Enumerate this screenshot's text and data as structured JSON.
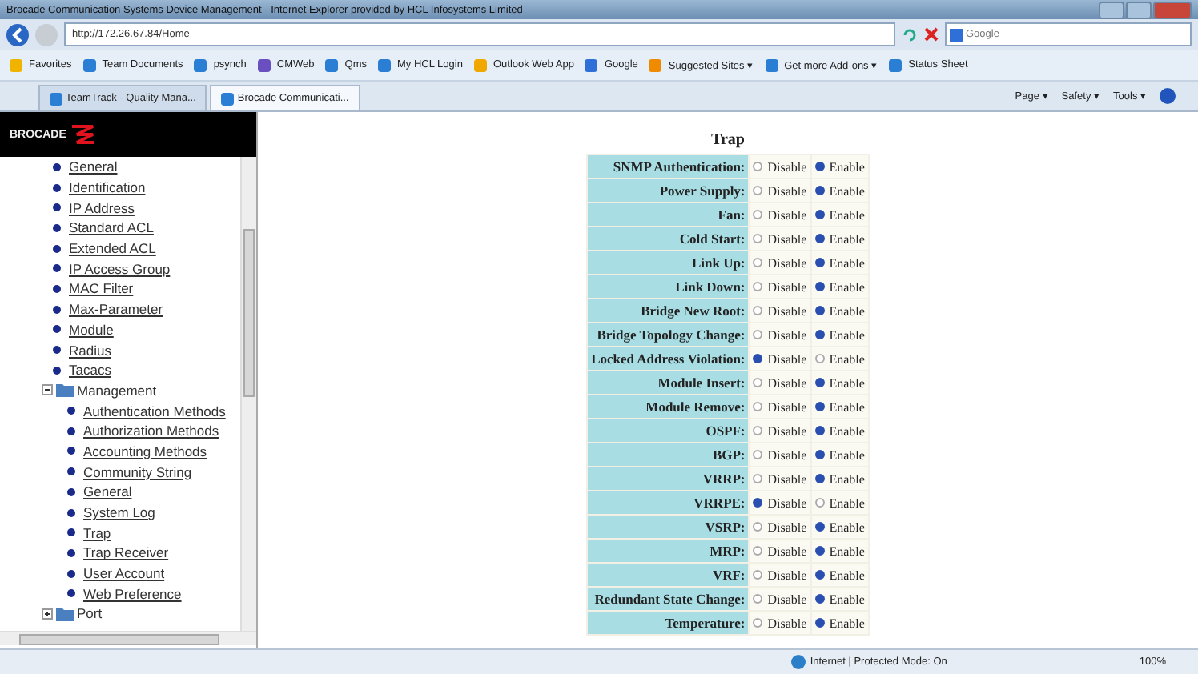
{
  "window": {
    "title": "Brocade Communication Systems Device Management - Internet Explorer provided by HCL Infosystems Limited"
  },
  "address": {
    "value": "http://172.26.67.84/Home"
  },
  "search": {
    "placeholder": "Google"
  },
  "favorites": [
    {
      "label": "Favorites",
      "kind": "star"
    },
    {
      "label": "Team Documents",
      "kind": "page"
    },
    {
      "label": "psynch",
      "kind": "page"
    },
    {
      "label": "CMWeb",
      "kind": "gear"
    },
    {
      "label": "Qms",
      "kind": "page"
    },
    {
      "label": "My HCL Login",
      "kind": "page"
    },
    {
      "label": "Outlook Web App",
      "kind": "mail"
    },
    {
      "label": "Google",
      "kind": "google"
    },
    {
      "label": "Suggested Sites ▾",
      "kind": "feed"
    },
    {
      "label": "Get more Add-ons ▾",
      "kind": "page"
    },
    {
      "label": "Status Sheet",
      "kind": "page"
    }
  ],
  "tabs": [
    {
      "label": "TeamTrack - Quality Mana...",
      "selected": false
    },
    {
      "label": "Brocade Communicati...",
      "selected": true
    }
  ],
  "commands": [
    "Page ▾",
    "Safety ▾",
    "Tools ▾"
  ],
  "sidebar": {
    "logo": "BROCADE",
    "items": [
      {
        "label": "General"
      },
      {
        "label": "Identification"
      },
      {
        "label": "IP Address"
      },
      {
        "label": "Standard ACL"
      },
      {
        "label": "Extended ACL"
      },
      {
        "label": "IP Access Group"
      },
      {
        "label": "MAC Filter"
      },
      {
        "label": "Max-Parameter"
      },
      {
        "label": "Module"
      },
      {
        "label": "Radius"
      },
      {
        "label": "Tacacs"
      },
      {
        "label": "Management",
        "expanded": true,
        "children": [
          {
            "label": "Authentication Methods"
          },
          {
            "label": "Authorization Methods"
          },
          {
            "label": "Accounting Methods"
          },
          {
            "label": "Community String"
          },
          {
            "label": "General"
          },
          {
            "label": "System Log"
          },
          {
            "label": "Trap"
          },
          {
            "label": "Trap Receiver"
          },
          {
            "label": "User Account"
          },
          {
            "label": "Web Preference"
          }
        ]
      },
      {
        "label": "Port",
        "expanded": false
      }
    ]
  },
  "trap": {
    "title": "Trap",
    "rows": [
      {
        "label": "SNMP Authentication:",
        "options": [
          {
            "label": "Disable",
            "selected": false
          },
          {
            "label": "Enable",
            "selected": true
          }
        ]
      },
      {
        "label": "Power Supply:",
        "options": [
          {
            "label": "Disable",
            "selected": false
          },
          {
            "label": "Enable",
            "selected": true
          }
        ]
      },
      {
        "label": "Fan:",
        "options": [
          {
            "label": "Disable",
            "selected": false
          },
          {
            "label": "Enable",
            "selected": true
          }
        ]
      },
      {
        "label": "Cold Start:",
        "options": [
          {
            "label": "Disable",
            "selected": false
          },
          {
            "label": "Enable",
            "selected": true
          }
        ]
      },
      {
        "label": "Link Up:",
        "options": [
          {
            "label": "Disable",
            "selected": false
          },
          {
            "label": "Enable",
            "selected": true
          }
        ]
      },
      {
        "label": "Link Down:",
        "options": [
          {
            "label": "Disable",
            "selected": false
          },
          {
            "label": "Enable",
            "selected": true
          }
        ]
      },
      {
        "label": "Bridge New Root:",
        "options": [
          {
            "label": "Disable",
            "selected": false
          },
          {
            "label": "Enable",
            "selected": true
          }
        ]
      },
      {
        "label": "Bridge Topology Change:",
        "options": [
          {
            "label": "Disable",
            "selected": false
          },
          {
            "label": "Enable",
            "selected": true
          }
        ]
      },
      {
        "label": "Locked Address Violation:",
        "options": [
          {
            "label": "Disable",
            "selected": true
          },
          {
            "label": "Enable",
            "selected": false
          }
        ]
      },
      {
        "label": "Module Insert:",
        "options": [
          {
            "label": "Disable",
            "selected": false
          },
          {
            "label": "Enable",
            "selected": true
          }
        ]
      },
      {
        "label": "Module Remove:",
        "options": [
          {
            "label": "Disable",
            "selected": false
          },
          {
            "label": "Enable",
            "selected": true
          }
        ]
      },
      {
        "label": "OSPF:",
        "options": [
          {
            "label": "Disable",
            "selected": false
          },
          {
            "label": "Enable",
            "selected": true
          }
        ]
      },
      {
        "label": "BGP:",
        "options": [
          {
            "label": "Disable",
            "selected": false
          },
          {
            "label": "Enable",
            "selected": true
          }
        ]
      },
      {
        "label": "VRRP:",
        "options": [
          {
            "label": "Disable",
            "selected": false
          },
          {
            "label": "Enable",
            "selected": true
          }
        ]
      },
      {
        "label": "VRRPE:",
        "options": [
          {
            "label": "Disable",
            "selected": true
          },
          {
            "label": "Enable",
            "selected": false
          }
        ]
      },
      {
        "label": "VSRP:",
        "options": [
          {
            "label": "Disable",
            "selected": false
          },
          {
            "label": "Enable",
            "selected": true
          }
        ]
      },
      {
        "label": "MRP:",
        "options": [
          {
            "label": "Disable",
            "selected": false
          },
          {
            "label": "Enable",
            "selected": true
          }
        ]
      },
      {
        "label": "VRF:",
        "options": [
          {
            "label": "Disable",
            "selected": false
          },
          {
            "label": "Enable",
            "selected": true
          }
        ]
      },
      {
        "label": "Redundant State Change:",
        "options": [
          {
            "label": "Disable",
            "selected": false
          },
          {
            "label": "Enable",
            "selected": true
          }
        ]
      },
      {
        "label": "Temperature:",
        "options": [
          {
            "label": "Disable",
            "selected": false
          },
          {
            "label": "Enable",
            "selected": true
          }
        ]
      }
    ]
  },
  "status": {
    "zone": "Internet | Protected Mode: On",
    "zoom": "100%"
  }
}
